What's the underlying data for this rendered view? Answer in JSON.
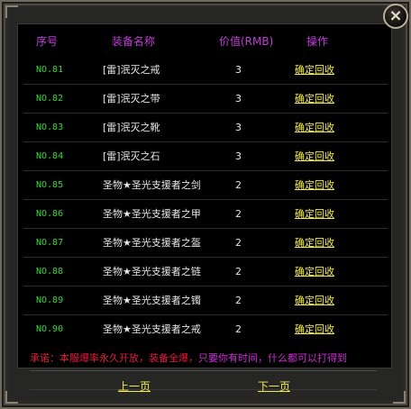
{
  "headers": {
    "index": "序号",
    "name": "装备名称",
    "price": "价值(RMB)",
    "action": "操作"
  },
  "rows": [
    {
      "num": "NO.81",
      "name": "[雷]泯灭之戒",
      "price": "3",
      "action": "确定回收"
    },
    {
      "num": "NO.82",
      "name": "[雷]泯灭之带",
      "price": "3",
      "action": "确定回收"
    },
    {
      "num": "NO.83",
      "name": "[雷]泯灭之靴",
      "price": "3",
      "action": "确定回收"
    },
    {
      "num": "NO.84",
      "name": "[雷]泯灭之石",
      "price": "3",
      "action": "确定回收"
    },
    {
      "num": "NO.85",
      "name": "圣物★圣光支援者之剑",
      "price": "2",
      "action": "确定回收"
    },
    {
      "num": "NO.86",
      "name": "圣物★圣光支援者之甲",
      "price": "2",
      "action": "确定回收"
    },
    {
      "num": "NO.87",
      "name": "圣物★圣光支援者之盔",
      "price": "2",
      "action": "确定回收"
    },
    {
      "num": "NO.88",
      "name": "圣物★圣光支援者之链",
      "price": "2",
      "action": "确定回收"
    },
    {
      "num": "NO.89",
      "name": "圣物★圣光支援者之镯",
      "price": "2",
      "action": "确定回收"
    },
    {
      "num": "NO.90",
      "name": "圣物★圣光支援者之戒",
      "price": "2",
      "action": "确定回收"
    }
  ],
  "notice": {
    "lead": "承诺：本服爆率永久开放，装备全爆，",
    "tail": "只要你有时间，什么都可以打得到"
  },
  "pager": {
    "prev": "上一页",
    "next": "下一页"
  },
  "close_label": "×",
  "colors": {
    "header": "#c03cd8",
    "number": "#38d838",
    "action": "#f2ee4a",
    "notice": "#e4183a"
  },
  "icons": {
    "close": "close-icon"
  }
}
